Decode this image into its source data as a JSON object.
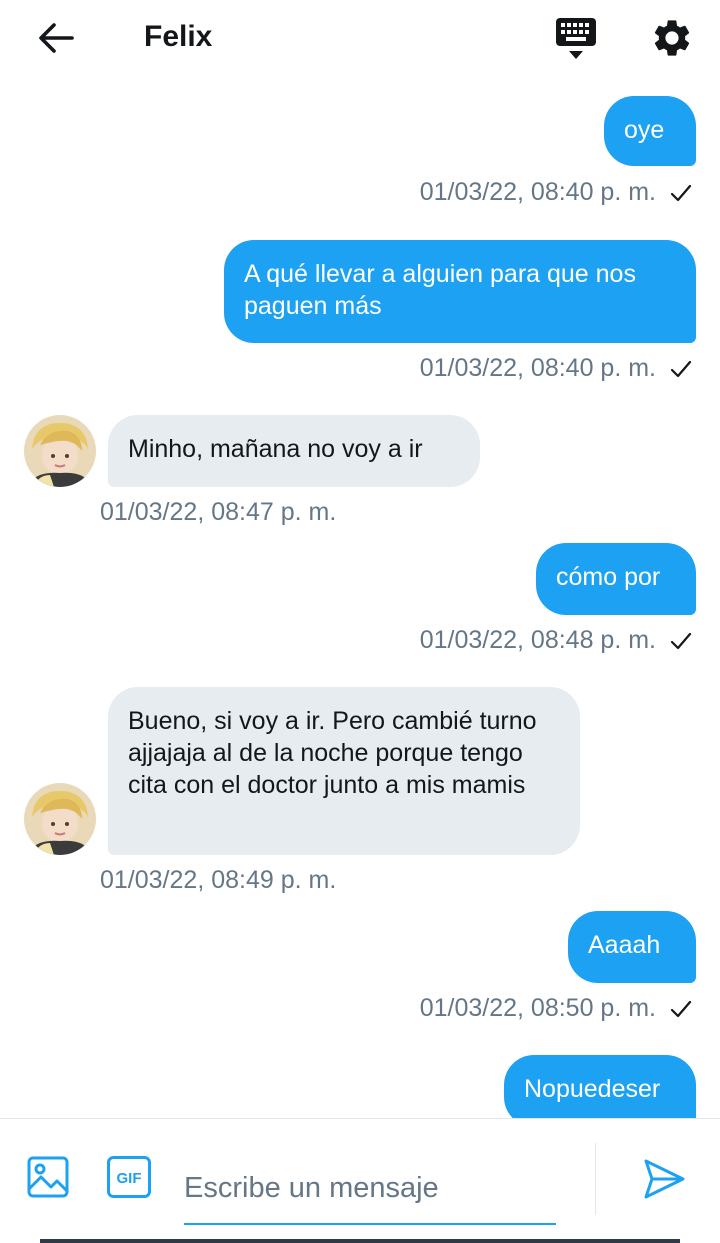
{
  "header": {
    "title": "Felix",
    "icons": [
      "back-arrow-icon",
      "keyboard-icon",
      "gear-icon"
    ]
  },
  "colors": {
    "accent": "#1da1f2",
    "incoming_bubble": "#e6ecf0",
    "timestamp": "#657786"
  },
  "messages": [
    {
      "direction": "out",
      "text": "oye",
      "time": "01/03/22, 08:40 p. m.",
      "read": true
    },
    {
      "direction": "out",
      "text": "A qué llevar a alguien para que nos paguen más",
      "time": "01/03/22, 08:40 p. m.",
      "read": true
    },
    {
      "direction": "in",
      "text": "Minho, mañana no voy a ir",
      "time": "01/03/22, 08:47 p. m."
    },
    {
      "direction": "out",
      "text": "cómo por",
      "time": "01/03/22, 08:48 p. m.",
      "read": true
    },
    {
      "direction": "in",
      "text": "Bueno, si voy a ir. Pero cambié turno ajjajaja al de la noche porque tengo cita con el doctor junto a mis mamis",
      "time": "01/03/22, 08:49 p. m."
    },
    {
      "direction": "out",
      "text": "Aaaah",
      "time": "01/03/22, 08:50 p. m.",
      "read": true
    },
    {
      "direction": "out",
      "text": "Nopuedeser"
    }
  ],
  "composer": {
    "placeholder": "Escribe un mensaje",
    "value": "",
    "gif_label": "GIF",
    "icons": [
      "image-icon",
      "gif-icon",
      "send-icon"
    ]
  }
}
